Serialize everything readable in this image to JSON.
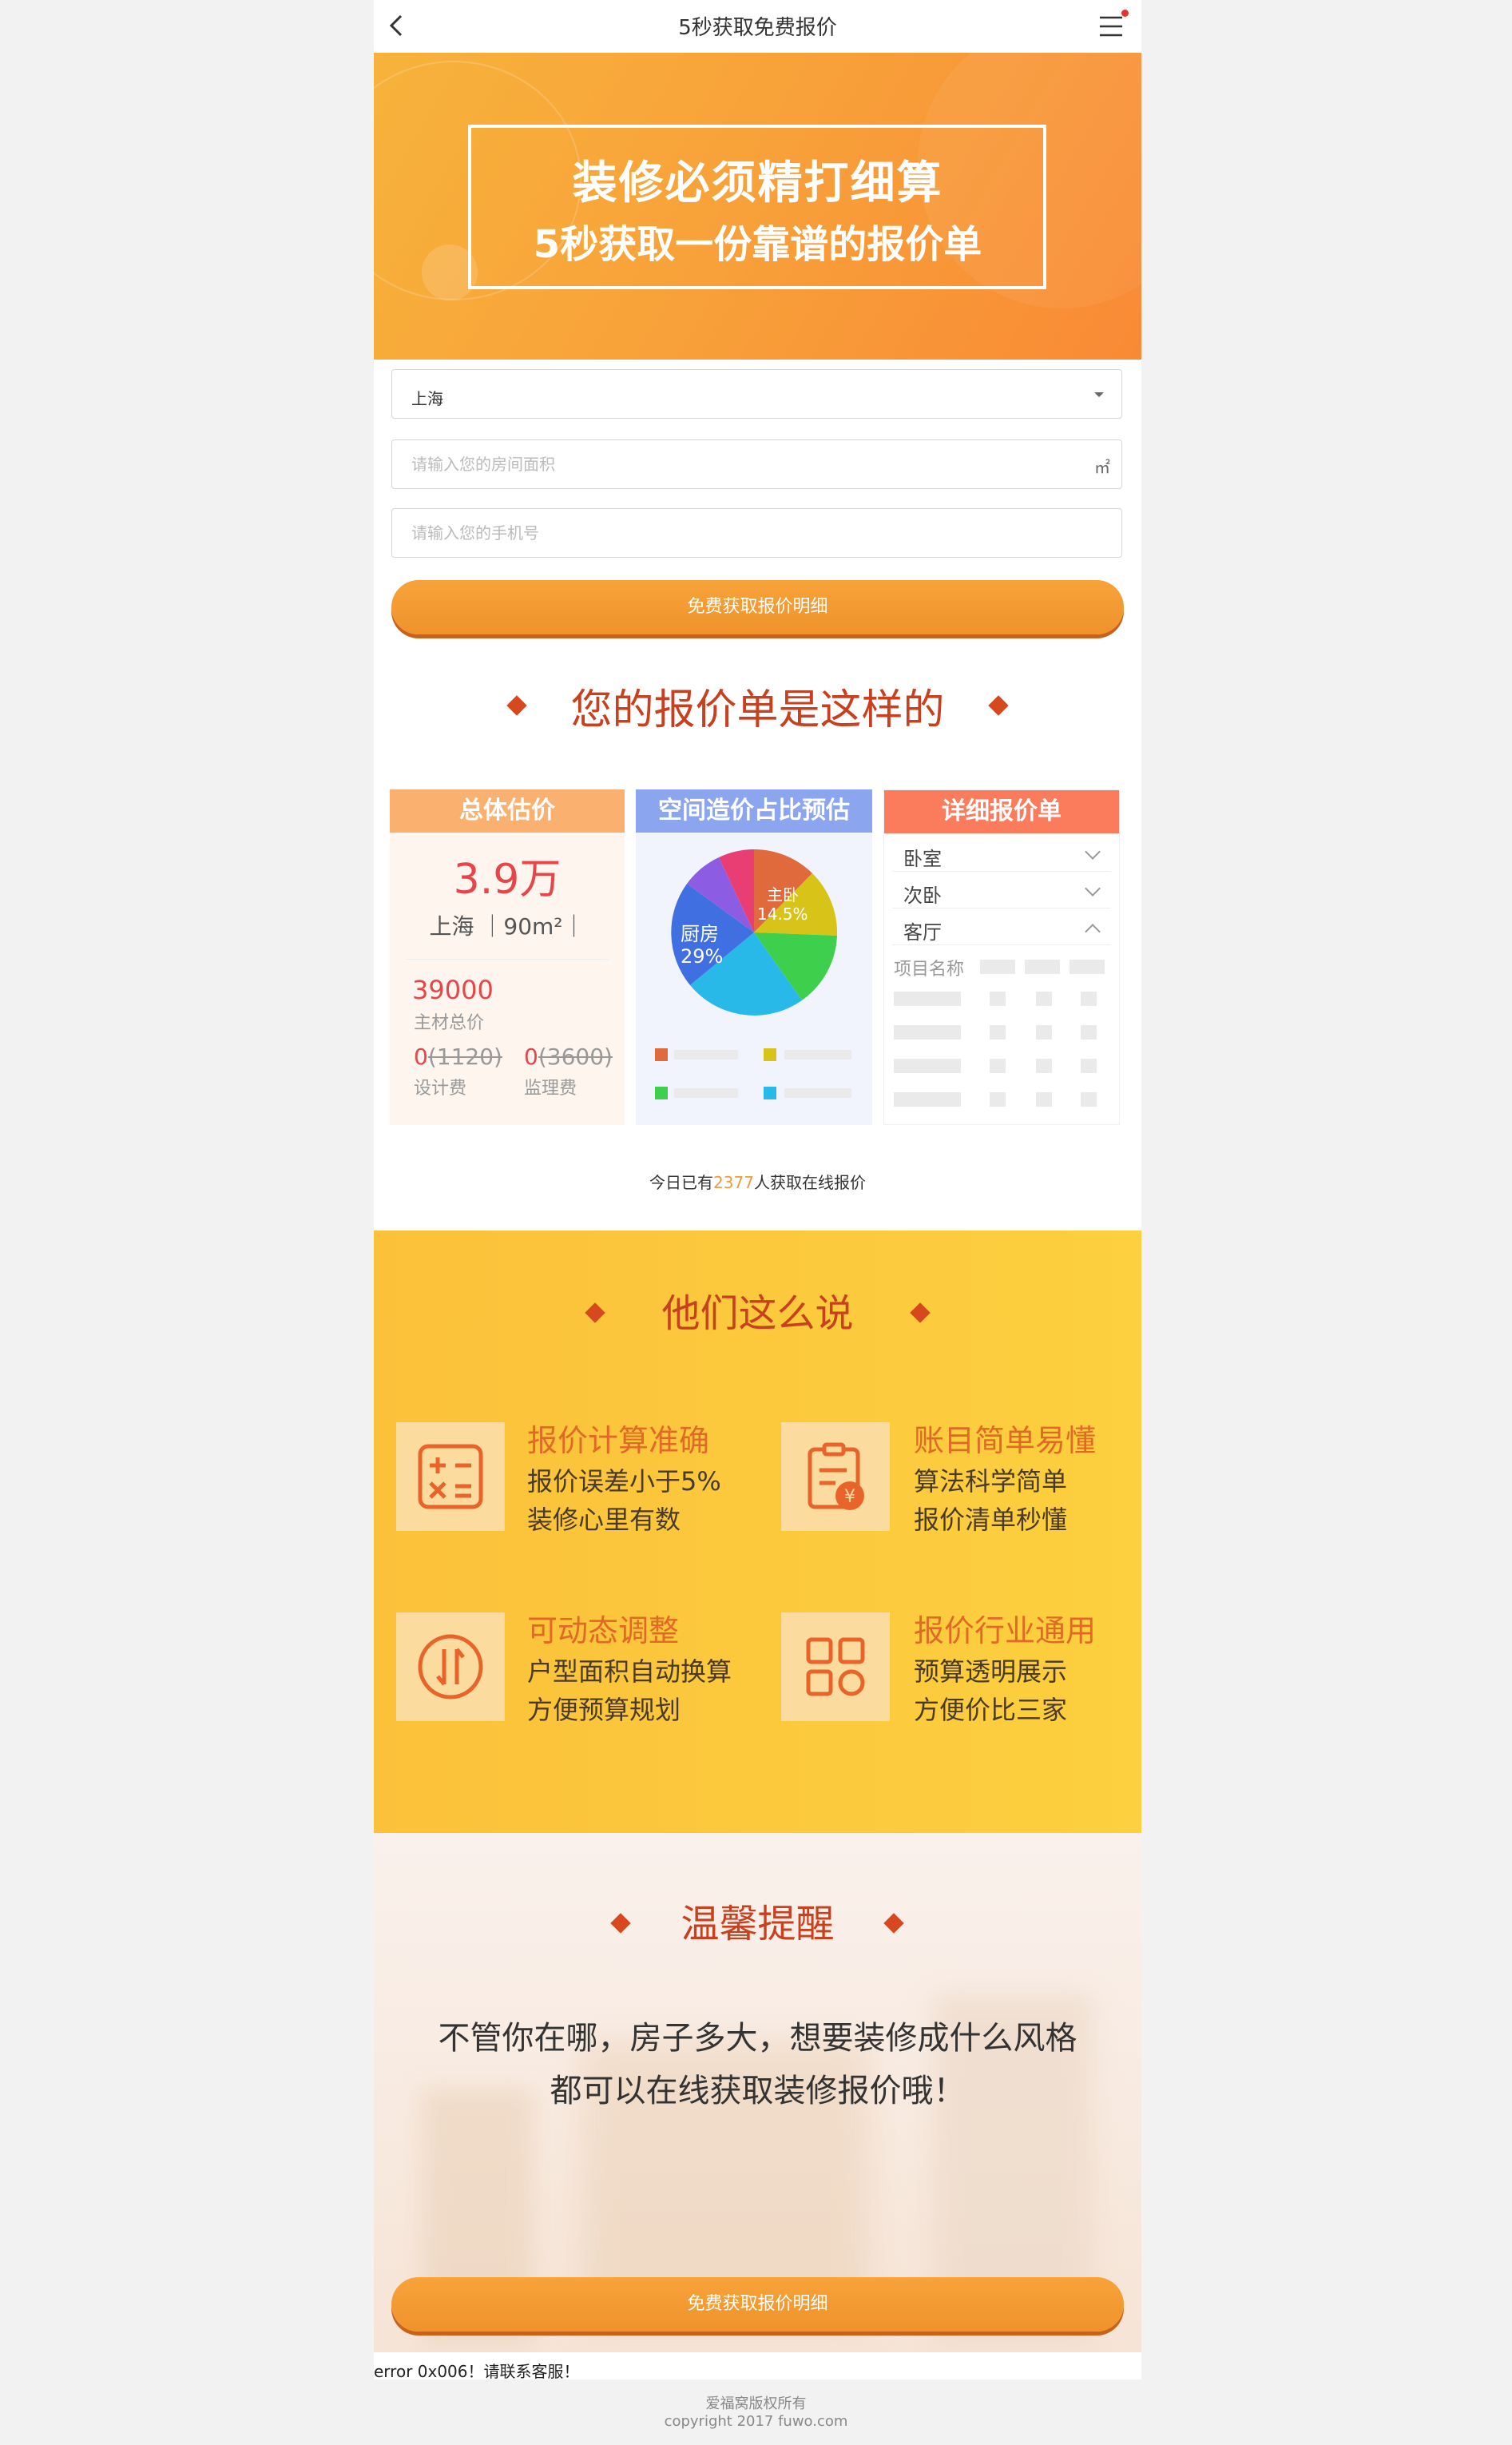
{
  "nav": {
    "title": "5秒获取免费报价",
    "back_icon": "chevron-left-icon",
    "menu_icon": "hamburger-icon"
  },
  "banner": {
    "line1": "装修必须精打细算",
    "line2": "5秒获取一份靠谱的报价单"
  },
  "form": {
    "city_value": "上海",
    "area_placeholder": "请输入您的房间面积",
    "area_unit": "㎡",
    "phone_placeholder": "请输入您的手机号",
    "submit_label": "免费获取报价明细"
  },
  "quote_section": {
    "title": "您的报价单是这样的"
  },
  "cards": {
    "total": {
      "head": "总体估价",
      "amount": "3.9万",
      "location": "上海 ｜90m²｜",
      "material_amount": "39000",
      "material_label": "主材总价",
      "design_fee": "0",
      "design_fee_orig": "(1120)",
      "design_label": "设计费",
      "supervision_fee": "0",
      "supervision_fee_orig": "(3600)",
      "supervision_label": "监理费"
    },
    "ratio": {
      "head": "空间造价占比预估",
      "slice_main_name": "主卧",
      "slice_main_pct": "14.5%",
      "slice_kitchen_name": "厨房",
      "slice_kitchen_pct": "29%"
    },
    "detail": {
      "head": "详细报价单",
      "rooms": [
        "卧室",
        "次卧",
        "客厅"
      ],
      "project_label": "项目名称"
    }
  },
  "counter": {
    "prefix": "今日已有",
    "number": "2377",
    "suffix": "人获取在线报价"
  },
  "testimonials": {
    "title": "他们这么说",
    "items": [
      {
        "title": "报价计算准确",
        "line1": "报价误差小于5%",
        "line2": "装修心里有数",
        "icon": "calculator-icon"
      },
      {
        "title": "账目简单易懂",
        "line1": "算法科学简单",
        "line2": "报价清单秒懂",
        "icon": "clipboard-yen-icon"
      },
      {
        "title": "可动态调整",
        "line1": "户型面积自动换算",
        "line2": "方便预算规划",
        "icon": "swap-arrows-icon"
      },
      {
        "title": "报价行业通用",
        "line1": "预算透明展示",
        "line2": "方便价比三家",
        "icon": "grid-apps-icon"
      }
    ]
  },
  "tip": {
    "title": "温馨提醒",
    "line1": "不管你在哪，房子多大，想要装修成什么风格",
    "line2": "都可以在线获取装修报价哦！",
    "button_label": "免费获取报价明细"
  },
  "error_text": "error 0x006！请联系客服！",
  "footer": {
    "line1": "爱福窝版权所有",
    "line2": "copyright 2017 fuwo.com"
  },
  "colors": {
    "accent": "#f29b3b",
    "heading": "#c8401e",
    "yellow": "#fcc83c"
  }
}
